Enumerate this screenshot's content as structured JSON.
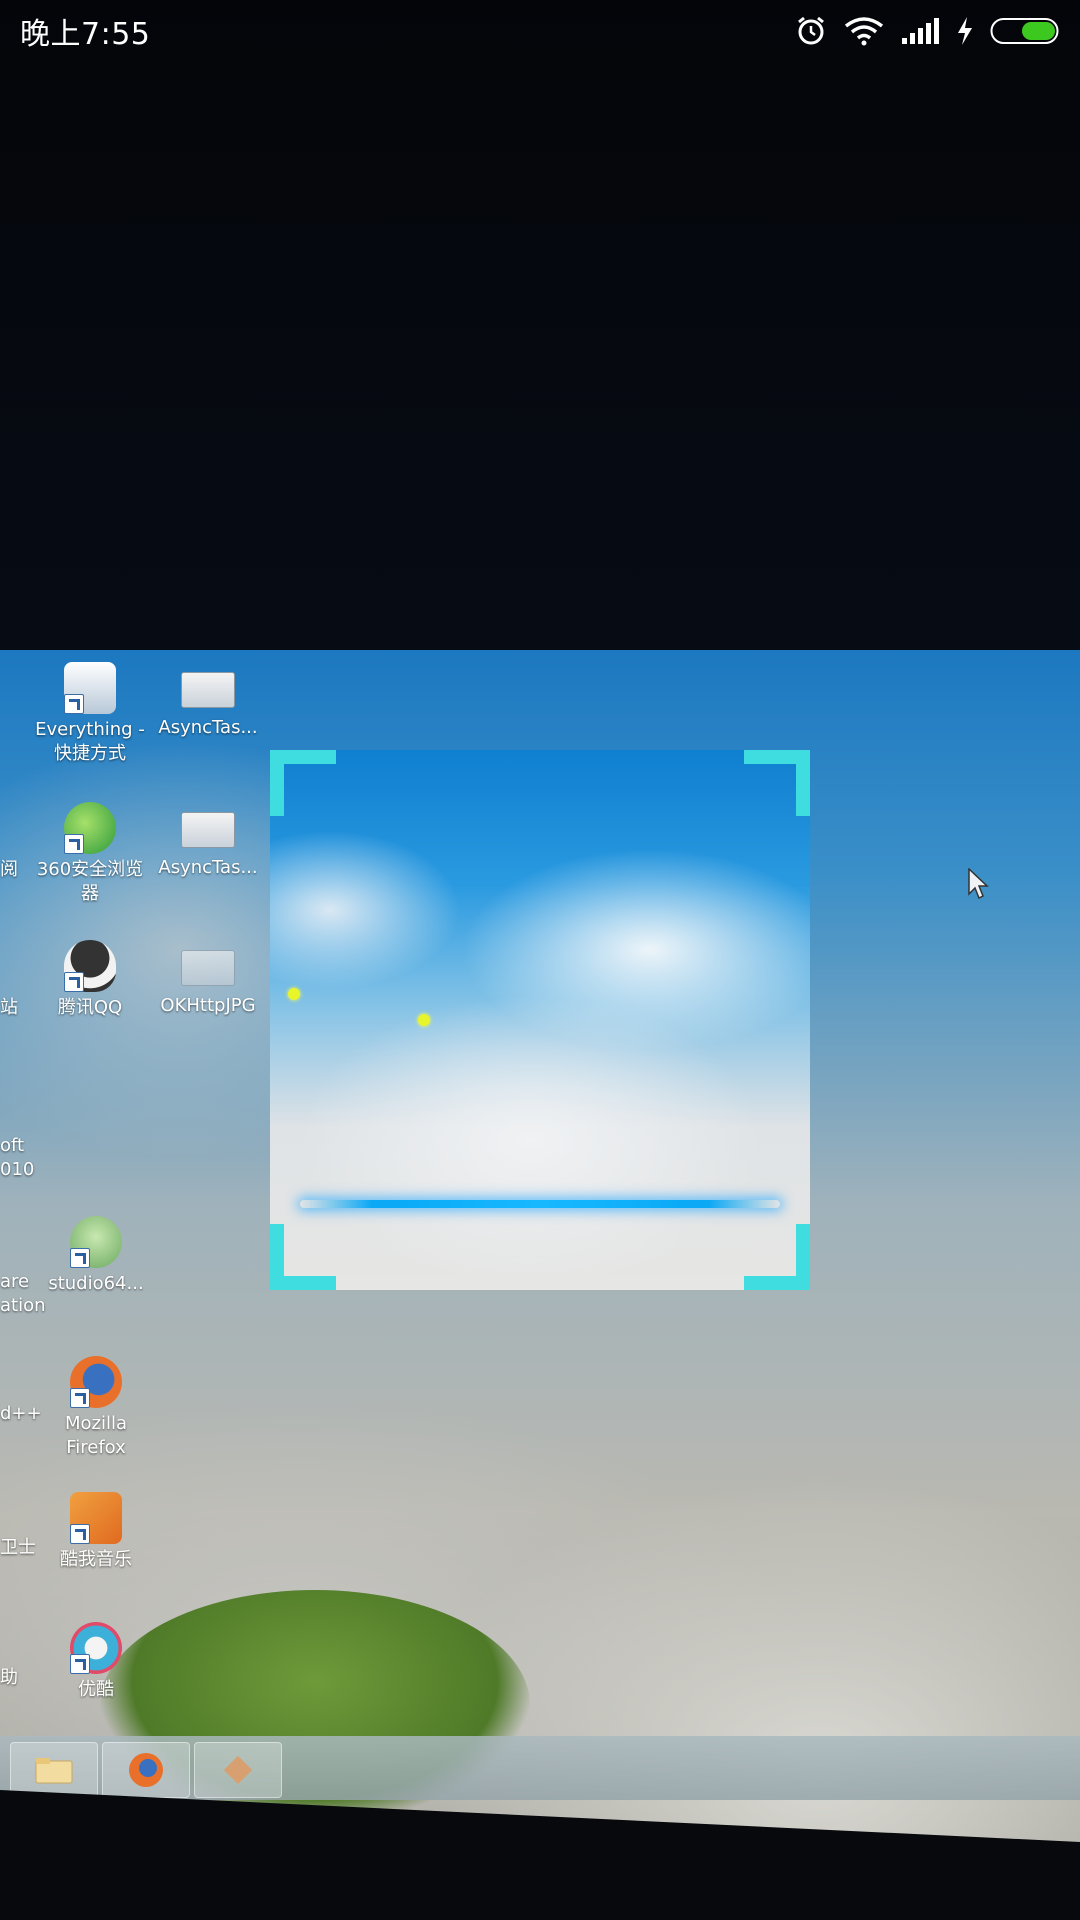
{
  "status_bar": {
    "time": "晚上7:55",
    "icons": [
      "alarm-icon",
      "wifi-icon",
      "signal-icon",
      "charging-icon",
      "battery-icon"
    ],
    "battery_color": "#3cc81e"
  },
  "desktop": {
    "icons": [
      {
        "label": "Everything -\n快捷方式"
      },
      {
        "label": "AsyncTas..."
      },
      {
        "label": "360安全浏览\n器"
      },
      {
        "label": "AsyncTas..."
      },
      {
        "label": "腾讯QQ"
      },
      {
        "label": "OKHttpJPG"
      },
      {
        "label": "studio64..."
      },
      {
        "label": "Mozilla\nFirefox"
      },
      {
        "label": "酷我音乐"
      },
      {
        "label": "优酷"
      }
    ],
    "partial_labels": [
      "阅",
      "站",
      "oft\n010",
      "are\nation",
      "d++",
      "卫士",
      "助"
    ]
  },
  "scanner": {
    "frame_color": "#3fdde0",
    "line_color": "#18b8ff",
    "dot_color": "#e8f52a"
  }
}
